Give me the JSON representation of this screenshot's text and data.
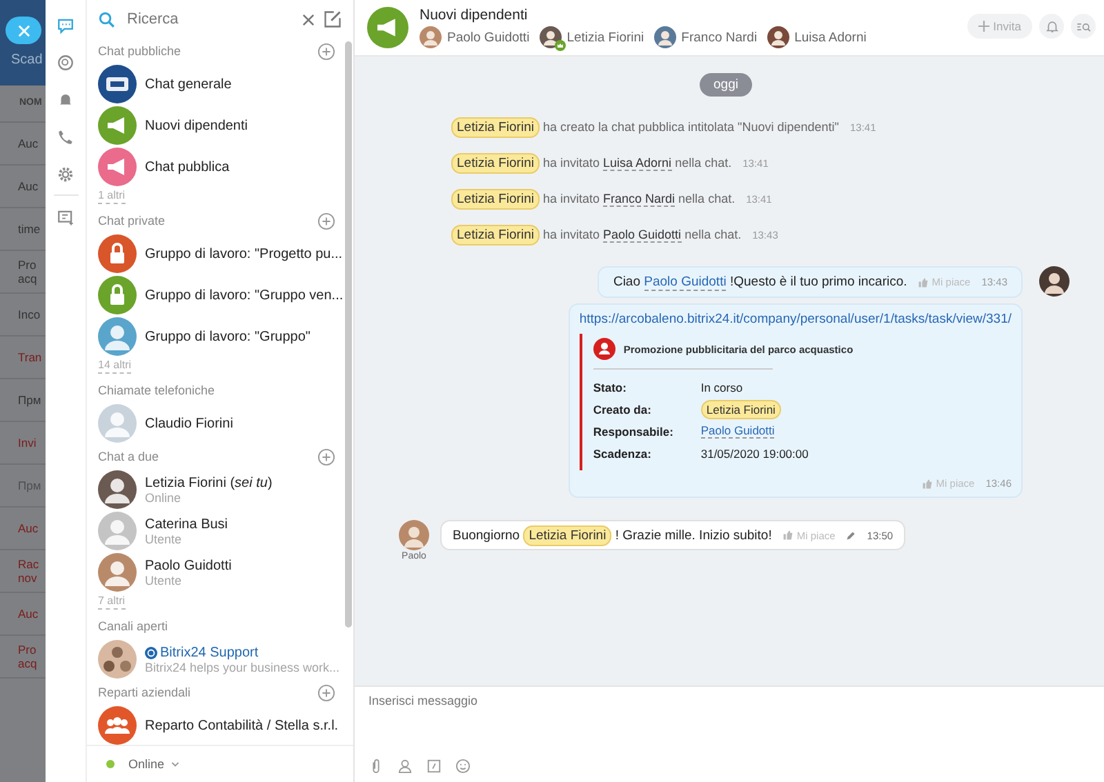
{
  "background_page": {
    "title": "Scad",
    "column_header": "NOM",
    "rows": [
      {
        "text": "Auc",
        "kind": "normal"
      },
      {
        "text": "Auc",
        "kind": "normal"
      },
      {
        "text": "time",
        "kind": "normal"
      },
      {
        "text": "Pro\nacq",
        "kind": "normal"
      },
      {
        "text": "Inco",
        "kind": "normal"
      },
      {
        "text": "Tran",
        "kind": "overdue"
      },
      {
        "text": "Прм",
        "kind": "normal"
      },
      {
        "text": "Invi",
        "kind": "overdue"
      },
      {
        "text": "Прм",
        "kind": "faded"
      },
      {
        "text": "Auc",
        "kind": "overdue"
      },
      {
        "text": "Rac\nnov",
        "kind": "overdue"
      },
      {
        "text": "Auc",
        "kind": "overdue"
      },
      {
        "text": "Pro\nacq",
        "kind": "overdue"
      }
    ]
  },
  "nav_icons": [
    {
      "kind": "chat",
      "selected": true
    },
    {
      "kind": "history",
      "selected": false
    },
    {
      "kind": "bell",
      "selected": false
    },
    {
      "kind": "phone",
      "selected": false
    },
    {
      "kind": "settings",
      "selected": false
    },
    {
      "kind": "notes",
      "selected": false
    }
  ],
  "search": {
    "placeholder": "Ricerca"
  },
  "sections": [
    {
      "title": "Chat pubbliche",
      "addable": true,
      "more": "1 altri",
      "items": [
        {
          "name": "Chat generale",
          "kind": "logo",
          "color": "#1f4e8c"
        },
        {
          "name": "Nuovi dipendenti",
          "kind": "megaphone",
          "color": "#6aa42b"
        },
        {
          "name": "Chat pubblica",
          "kind": "megaphone",
          "color": "#ea6b8b"
        }
      ]
    },
    {
      "title": "Chat private",
      "addable": true,
      "more": "14 altri",
      "items": [
        {
          "name": "Gruppo di lavoro: \"Progetto pu...",
          "kind": "lock",
          "color": "#d9552a"
        },
        {
          "name": "Gruppo di lavoro: \"Gruppo ven...",
          "kind": "lock",
          "color": "#6aa42b"
        },
        {
          "name": "Gruppo di lavoro: \"Gruppo\"",
          "kind": "person",
          "color": "#5aa5cc"
        }
      ]
    },
    {
      "title": "Chiamate telefoniche",
      "addable": false,
      "items": [
        {
          "name": "Claudio Fiorini",
          "kind": "photo",
          "color": "#c9d3dc"
        }
      ]
    },
    {
      "title": "Chat a due",
      "addable": true,
      "more": "7 altri",
      "items": [
        {
          "name": "Letizia Fiorini (*sei tu*)",
          "subtitle": "Online",
          "kind": "photo",
          "color": "#6b5a52"
        },
        {
          "name": "Caterina Busi",
          "subtitle": "Utente",
          "kind": "person",
          "color": "#c4c4c4"
        },
        {
          "name": "Paolo Guidotti",
          "subtitle": "Utente",
          "kind": "photo",
          "color": "#b98a6a"
        }
      ]
    },
    {
      "title": "Canali aperti",
      "addable": false,
      "items": [
        {
          "name": "Bitrix24 Support",
          "subtitle": "Bitrix24 helps your business work...",
          "kind": "channel",
          "color": "#d8b8a0"
        }
      ]
    },
    {
      "title": "Reparti aziendali",
      "addable": true,
      "items": [
        {
          "name": "Reparto Contabilità / Stella s.r.l.",
          "kind": "people",
          "color": "#e2572a"
        }
      ]
    }
  ],
  "status": "Online",
  "chat": {
    "title": "Nuovi dipendenti",
    "members": [
      {
        "name": "Paolo Guidotti",
        "owner": false
      },
      {
        "name": "Letizia Fiorini",
        "owner": true
      },
      {
        "name": "Franco Nardi",
        "owner": false
      },
      {
        "name": "Luisa Adorni",
        "owner": false
      }
    ],
    "invite_button": "Invita",
    "date": "oggi",
    "system_messages": [
      {
        "author": "Letizia Fiorini",
        "text": "ha creato la chat pubblica intitolata \"Nuovi dipendenti\"",
        "time": "13:41"
      },
      {
        "author": "Letizia Fiorini",
        "text": "ha invitato",
        "mention": "Luisa Adorni",
        "after": "nella chat.",
        "time": "13:41"
      },
      {
        "author": "Letizia Fiorini",
        "text": "ha invitato",
        "mention": "Franco Nardi",
        "after": "nella chat.",
        "time": "13:41"
      },
      {
        "author": "Letizia Fiorini",
        "text": "ha invitato",
        "mention": "Paolo Guidotti",
        "after": "nella chat.",
        "time": "13:43"
      }
    ],
    "own_message": {
      "before": "Ciao",
      "mention": "Paolo Guidotti",
      "after": "!Questo è il tuo primo incarico.",
      "like": "Mi piace",
      "time": "13:43"
    },
    "task_message": {
      "url": "https://arcobaleno.bitrix24.it/company/personal/user/1/tasks/task/view/331/",
      "title": "Promozione pubblicitaria del parco acquastico",
      "fields": [
        {
          "label": "Stato:",
          "value": "In corso",
          "kind": "text"
        },
        {
          "label": "Creato da:",
          "value": "Letizia Fiorini",
          "kind": "chip"
        },
        {
          "label": "Responsabile:",
          "value": "Paolo Guidotti",
          "kind": "link"
        },
        {
          "label": "Scadenza:",
          "value": "31/05/2020 19:00:00",
          "kind": "text"
        }
      ],
      "like": "Mi piace",
      "time": "13:46"
    },
    "reply": {
      "author": "Paolo",
      "before": "Buongiorno",
      "chip": "Letizia Fiorini",
      "after": "! Grazie mille. Inizio subito!",
      "like": "Mi piace",
      "time": "13:50",
      "edited": true
    },
    "input": {
      "placeholder": "Inserisci messaggio"
    }
  }
}
